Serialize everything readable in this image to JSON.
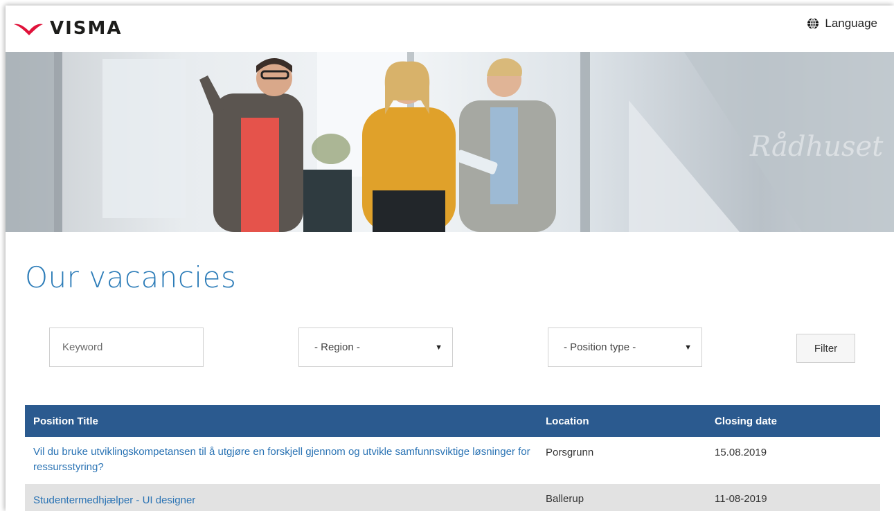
{
  "brand": {
    "name": "VISMA",
    "logo_color": "#e0123a"
  },
  "header": {
    "language_label": "Language",
    "language_icon": "globe-icon"
  },
  "page": {
    "title": "Our vacancies"
  },
  "filters": {
    "keyword_placeholder": "Keyword",
    "region_value": "- Region -",
    "position_type_value": "- Position type -",
    "filter_label": "Filter"
  },
  "table": {
    "headers": {
      "title": "Position Title",
      "location": "Location",
      "closing": "Closing date"
    },
    "rows": [
      {
        "title": "Vil du bruke utviklingskompetansen til å utgjøre en forskjell gjennom og utvikle samfunnsviktige løsninger for ressursstyring?",
        "location": "Porsgrunn",
        "closing": "15.08.2019"
      },
      {
        "title": "Studentermedhjælper - UI designer",
        "location": "Ballerup",
        "closing": "11-08-2019"
      }
    ]
  },
  "colors": {
    "accent": "#2c7cb8",
    "header_bg": "#2b5a8f",
    "link": "#2a73b4",
    "row_alt": "#e2e2e2"
  }
}
